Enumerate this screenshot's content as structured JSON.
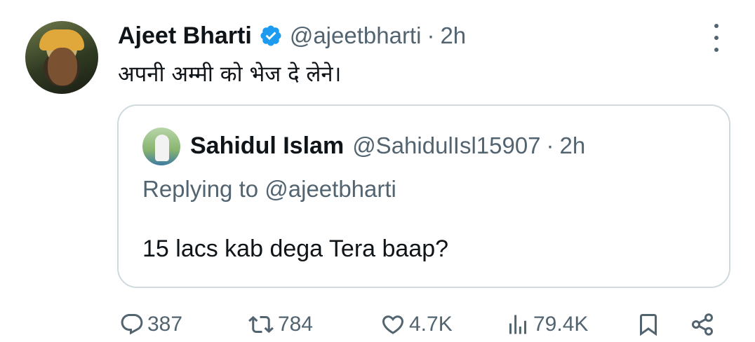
{
  "tweet": {
    "author_name": "Ajeet Bharti",
    "author_handle": "@ajeetbharti",
    "separator": "·",
    "time": "2h",
    "text": "अपनी अम्मी को भेज दे लेने।"
  },
  "quoted_tweet": {
    "author_name": "Sahidul Islam",
    "author_handle": "@SahidulIsl15907",
    "separator": "·",
    "time": "2h",
    "replying_to": "Replying to @ajeetbharti",
    "text": "15 lacs kab dega Tera baap?"
  },
  "actions": {
    "replies": "387",
    "reposts": "784",
    "likes": "4.7K",
    "views": "79.4K"
  },
  "icons": {
    "verified": "verified-badge-icon",
    "more": "more-icon",
    "reply": "reply-icon",
    "repost": "repost-icon",
    "like": "heart-icon",
    "views": "views-icon",
    "bookmark": "bookmark-icon",
    "share": "share-icon"
  },
  "colors": {
    "verified_blue": "#1d9bf0",
    "text_primary": "#0f1419",
    "text_secondary": "#536471",
    "border": "#cfd9de"
  }
}
